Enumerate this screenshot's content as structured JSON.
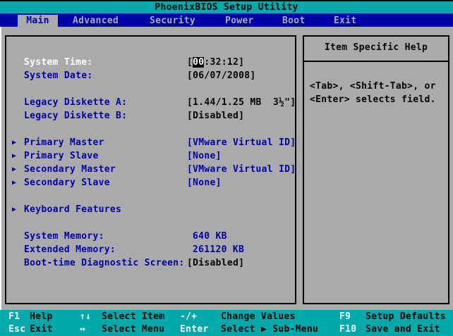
{
  "app": {
    "title": "PhoenixBIOS Setup Utility"
  },
  "menu_tabs": [
    {
      "label": "Main",
      "selected": true
    },
    {
      "label": "Advanced",
      "selected": false
    },
    {
      "label": "Security",
      "selected": false
    },
    {
      "label": "Power",
      "selected": false
    },
    {
      "label": "Boot",
      "selected": false
    },
    {
      "label": "Exit",
      "selected": false
    }
  ],
  "main": {
    "system_time": {
      "label": "System Time:",
      "value_prefix": "[",
      "value_highlight": "00",
      "value_suffix": ":32:12]"
    },
    "system_date": {
      "label": "System Date:",
      "value": "[06/07/2008]"
    },
    "legacy_diskette_a": {
      "label": "Legacy Diskette A:",
      "value": "[1.44/1.25 MB  3½\"]"
    },
    "legacy_diskette_b": {
      "label": "Legacy Diskette B:",
      "value": "[Disabled]"
    },
    "primary_master": {
      "label": "Primary Master",
      "value": "[VMware Virtual ID]"
    },
    "primary_slave": {
      "label": "Primary Slave",
      "value": "[None]"
    },
    "secondary_master": {
      "label": "Secondary Master",
      "value": "[VMware Virtual ID]"
    },
    "secondary_slave": {
      "label": "Secondary Slave",
      "value": "[None]"
    },
    "keyboard_features": {
      "label": "Keyboard Features"
    },
    "system_memory": {
      "label": "System Memory:",
      "value": "640 KB"
    },
    "extended_memory": {
      "label": "Extended Memory:",
      "value": "261120 KB"
    },
    "boot_time_diag": {
      "label": "Boot-time Diagnostic Screen:",
      "value": "[Disabled]"
    }
  },
  "help": {
    "title": "Item Specific Help",
    "line1": "<Tab>, <Shift-Tab>, or",
    "line2": "<Enter> selects field."
  },
  "footer": {
    "f1": {
      "key": "F1",
      "label": "Help"
    },
    "up_down": {
      "key": "↑↓",
      "label": "Select Item"
    },
    "minus_plus": {
      "key": "-/+",
      "label": "Change Values"
    },
    "f9": {
      "key": "F9",
      "label": "Setup Defaults"
    },
    "esc": {
      "key": "Esc",
      "label": "Exit"
    },
    "left_right": {
      "key": "↔",
      "label": "Select Menu"
    },
    "enter": {
      "key": "Enter",
      "label": "Select ▶ Sub-Menu"
    },
    "f10": {
      "key": "F10",
      "label": "Save and Exit"
    }
  },
  "colors": {
    "teal": "#00AAAA",
    "blue": "#0000AA",
    "gray": "#AAAAAA",
    "black": "#000000",
    "white": "#FFFFFF"
  }
}
